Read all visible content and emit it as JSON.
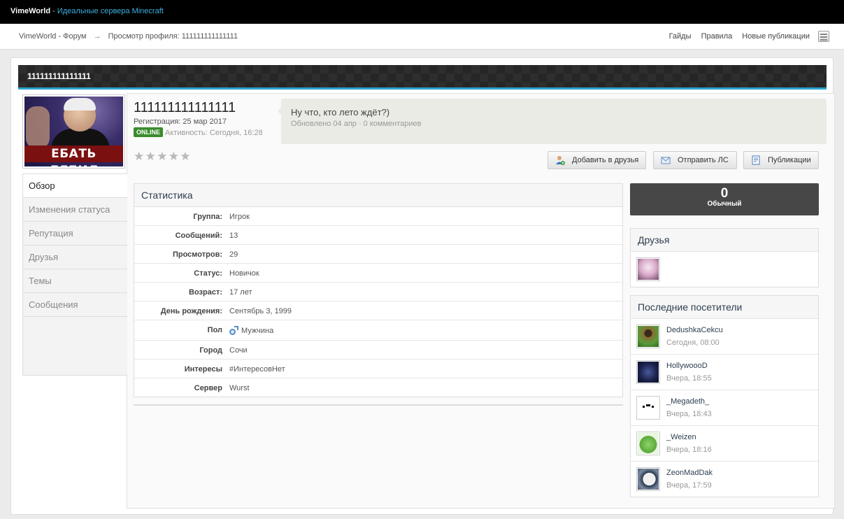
{
  "topbar": {
    "site": "VimeWorld",
    "separator": " - ",
    "tagline": "Идеальные сервера Minecraft"
  },
  "breadcrumb": {
    "forum": "VimeWorld - Форум",
    "arrow": "→",
    "current": "Просмотр профиля: 111111111111111"
  },
  "nav_links": [
    "Гайды",
    "Правила",
    "Новые публикации"
  ],
  "banner_title": "111111111111111",
  "avatar_caption": "ЕБАТЬ ДЕБИЛ",
  "profile": {
    "name": "111111111111111",
    "registration": "Регистрация: 25 мар 2017",
    "online_badge": "ONLINE",
    "activity": "Активность: Сегодня, 16:28",
    "rating_stars": [
      "★",
      "★",
      "★",
      "★",
      "★"
    ]
  },
  "status_update": {
    "text": "Ну что, кто лето ждёт?)",
    "meta": "Обновлено 04 апр · 0 комментариев"
  },
  "buttons": {
    "add_friend": "Добавить в друзья",
    "send_pm": "Отправить ЛС",
    "publications": "Публикации"
  },
  "left_nav": [
    "Обзор",
    "Изменения статуса",
    "Репутация",
    "Друзья",
    "Темы",
    "Сообщения"
  ],
  "stats": {
    "title": "Статистика",
    "rows": [
      {
        "label": "Группа:",
        "value": "Игрок"
      },
      {
        "label": "Сообщений:",
        "value": "13"
      },
      {
        "label": "Просмотров:",
        "value": "29"
      },
      {
        "label": "Статус:",
        "value": "Новичок"
      },
      {
        "label": "Возраст:",
        "value": "17 лет"
      },
      {
        "label": "День рождения:",
        "value": "Сентябрь 3, 1999"
      },
      {
        "label": "Пол",
        "value": "Мужчина"
      },
      {
        "label": "Город",
        "value": "Сочи"
      },
      {
        "label": "Интересы",
        "value": "#ИнтересовНет"
      },
      {
        "label": "Сервер",
        "value": "Wurst"
      }
    ]
  },
  "reputation": {
    "value": "0",
    "rank": "Обычный"
  },
  "friends": {
    "title": "Друзья"
  },
  "visitors": {
    "title": "Последние посетители",
    "items": [
      {
        "name": "DedushkaCekcu",
        "time": "Сегодня, 08:00"
      },
      {
        "name": "HollywoooD",
        "time": "Вчера, 18:55"
      },
      {
        "name": "_Megadeth_",
        "time": "Вчера, 18:43"
      },
      {
        "name": "_Weizen",
        "time": "Вчера, 18:16"
      },
      {
        "name": "ZeonMadDak",
        "time": "Вчера, 17:59"
      }
    ]
  },
  "colors": {
    "accent": "#2aa3cf",
    "online": "#3a8c2c",
    "brand_tagline": "#3fb0e0",
    "rep_box": "#474747"
  }
}
